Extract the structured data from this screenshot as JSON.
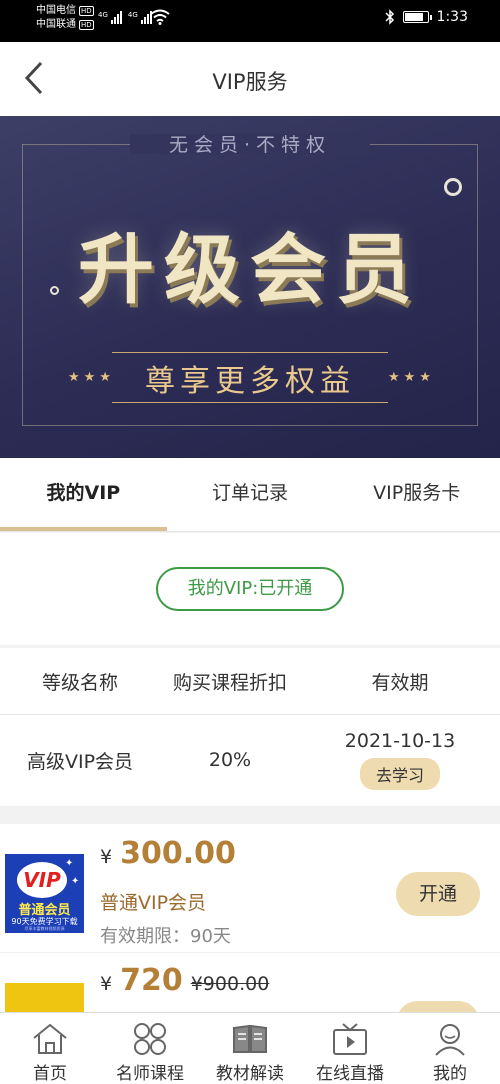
{
  "status_bar": {
    "carrier1": "中国电信",
    "carrier2": "中国联通",
    "hd": "HD",
    "net": "4G",
    "time": "1:33",
    "battery_level": 0.85
  },
  "header": {
    "back_icon": "chevron-left-icon",
    "title": "VIP服务"
  },
  "banner": {
    "subtitle": "无会员·不特权",
    "main": "升级会员",
    "tagline": "尊享更多权益",
    "stars": "★★★"
  },
  "tabs": [
    {
      "label": "我的VIP",
      "active": true
    },
    {
      "label": "订单记录",
      "active": false
    },
    {
      "label": "VIP服务卡",
      "active": false
    }
  ],
  "vip_status": {
    "label": "我的VIP:已开通",
    "color": "#3d9a45"
  },
  "vip_table": {
    "headers": [
      "等级名称",
      "购买课程折扣",
      "有效期"
    ],
    "row": {
      "level": "高级VIP会员",
      "discount": "20%",
      "expiry": "2021-10-13",
      "action": "去学习"
    }
  },
  "products": [
    {
      "currency": "¥",
      "price": "300.00",
      "original_price": "",
      "name": "普通VIP会员",
      "validity": "有效期限：90天",
      "button": "开通",
      "thumb_vip": "VIP",
      "thumb_title": "普通会员",
      "thumb_desc": "90天免费学习下载",
      "thumb_small": "尽享丰富教材视频资源"
    },
    {
      "currency": "¥",
      "price": "720",
      "original_price": "¥900.00"
    }
  ],
  "accent_color": "#b48037",
  "bottom_nav": [
    {
      "label": "首页",
      "icon": "home-icon"
    },
    {
      "label": "名师课程",
      "icon": "grid-icon"
    },
    {
      "label": "教材解读",
      "icon": "book-icon"
    },
    {
      "label": "在线直播",
      "icon": "tv-icon"
    },
    {
      "label": "我的",
      "icon": "user-icon"
    }
  ]
}
